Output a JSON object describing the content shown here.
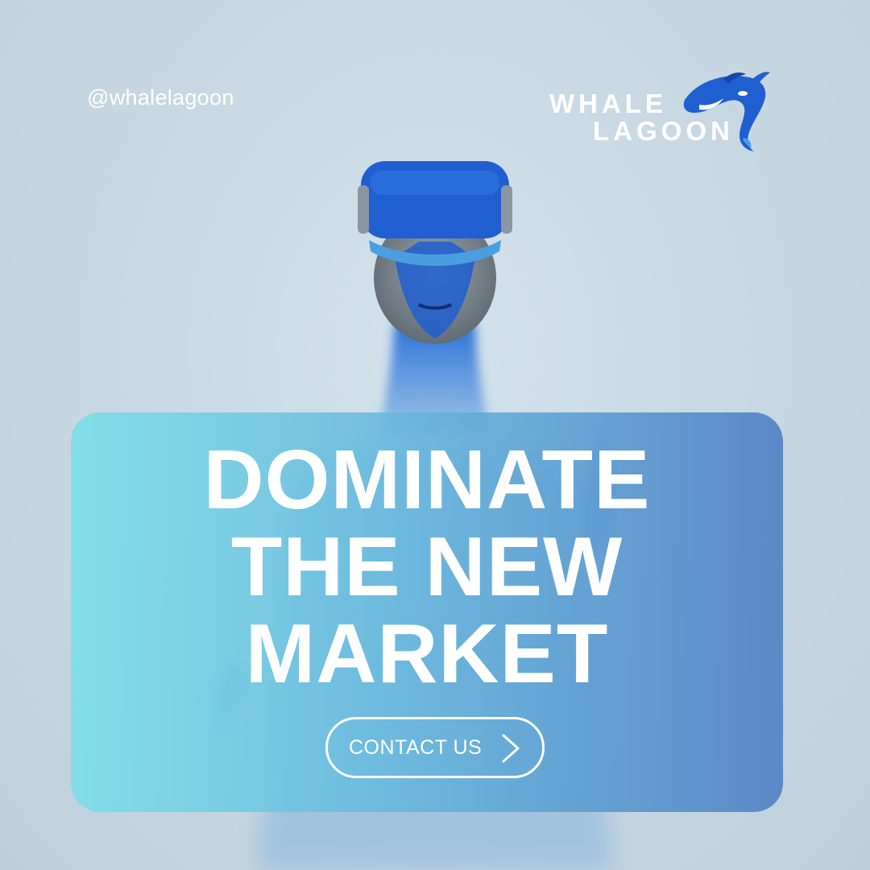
{
  "social": {
    "handle": "@whalelagoon"
  },
  "brand": {
    "line1": "WHALE",
    "line2": "LAGOON",
    "logo_icon": "orca-icon",
    "accent_color": "#1e63d6"
  },
  "hero": {
    "headline": [
      "DOMINATE",
      "THE NEW",
      "MARKET"
    ],
    "image": "vr-headset-figure"
  },
  "cta": {
    "label": "CONTACT US",
    "icon": "chevron-right-icon"
  },
  "colors": {
    "background": "#c9d9e3",
    "panel_start": "#7edee8",
    "panel_end": "#5080c4",
    "text": "#ffffff",
    "figure_blue": "#1f5fd0"
  }
}
